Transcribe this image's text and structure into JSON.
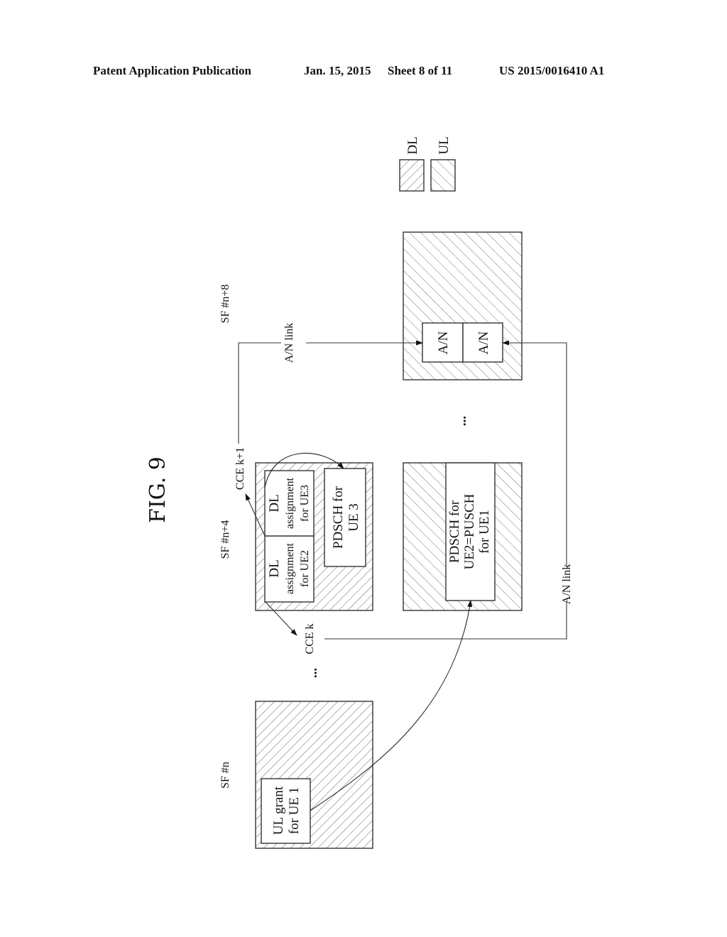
{
  "header": {
    "publication": "Patent Application Publication",
    "date": "Jan. 15, 2015",
    "sheet": "Sheet 8 of 11",
    "number": "US 2015/0016410 A1"
  },
  "figure": {
    "title": "FIG. 9",
    "legend": [
      {
        "label": "DL",
        "hatch": "backslash"
      },
      {
        "label": "UL",
        "hatch": "slash"
      }
    ],
    "subframes": [
      {
        "id": "sf-n",
        "label": "SF #n",
        "type": "DL",
        "blocks": [
          {
            "lines": [
              "UL grant",
              "for UE 1"
            ]
          }
        ]
      },
      {
        "id": "sf-n4",
        "label": "SF #n+4",
        "type": "DL",
        "blocks": [
          {
            "lines": [
              "DL",
              "assignment",
              "for UE2"
            ]
          },
          {
            "lines": [
              "DL",
              "assignment",
              "for UE3"
            ]
          },
          {
            "lines": [
              "PDSCH for",
              "UE 3"
            ]
          }
        ]
      },
      {
        "id": "sf-n4-ul",
        "label": "",
        "type": "UL",
        "blocks": [
          {
            "lines": [
              "PDSCH for",
              "UE2=PUSCH",
              "for UE1"
            ]
          }
        ]
      },
      {
        "id": "sf-n8",
        "label": "SF #n+8",
        "type": "UL",
        "blocks": [
          {
            "lines": [
              "A/N"
            ]
          },
          {
            "lines": [
              "A/N"
            ]
          }
        ]
      }
    ],
    "annotations": {
      "cce_k": "CCE k",
      "cce_k1": "CCE k+1",
      "an_link_top": "A/N link",
      "an_link_bottom": "A/N link",
      "ellipsis": "..."
    },
    "colors": {
      "ink": "#333333",
      "background": "#ffffff"
    }
  }
}
